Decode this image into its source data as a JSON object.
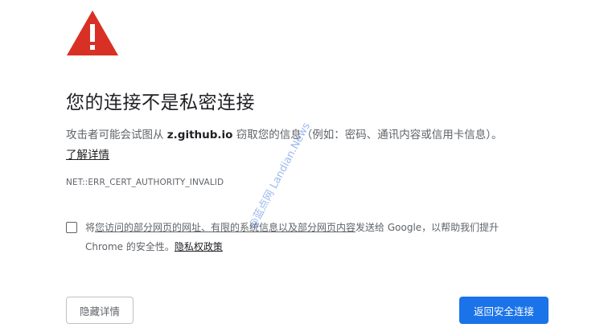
{
  "heading": {
    "title": "您的连接不是私密连接"
  },
  "description": {
    "before": "攻击者可能会试图从 ",
    "domain": "z.github.io",
    "after": " 窃取您的信息（例如：密码、通讯内容或信用卡信息）。"
  },
  "learn_more": "了解详情",
  "error_code": "NET::ERR_CERT_AUTHORITY_INVALID",
  "optin": {
    "prefix": "将",
    "link_text": "您访问的部分网页的网址、有限的系统信息以及部分网页内容",
    "suffix": "发送给 Google，以帮助我们提升",
    "line2_prefix": "Chrome 的安全性。",
    "privacy_link": "隐私权政策",
    "checked": false
  },
  "buttons": {
    "details": "隐藏详情",
    "back_to_safety": "返回安全连接"
  },
  "watermark": "@蓝点网 Landian.News",
  "colors": {
    "warning_red": "#d93025",
    "primary_blue": "#1a73e8",
    "text_primary": "#202124",
    "text_secondary": "#5f6368"
  }
}
